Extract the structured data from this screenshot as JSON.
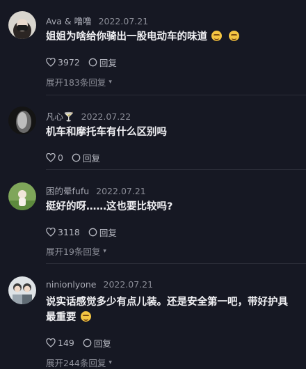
{
  "comments": [
    {
      "username": "Ava & 噜噜",
      "date": "2022.07.21",
      "text": "姐姐为啥给你骑出一股电动车的味道",
      "emoji": [
        "grin-emoji",
        "grin-emoji"
      ],
      "likes": "3972",
      "reply_label": "回复",
      "expand": "展开183条回复"
    },
    {
      "username": "凡心🍸",
      "date": "2022.07.22",
      "text": "机车和摩托车有什么区别吗",
      "likes": "0",
      "reply_label": "回复",
      "expand": ""
    },
    {
      "username": "困的晕fufu",
      "date": "2022.07.21",
      "text": "挺好的呀……这也要比较吗?",
      "likes": "3118",
      "reply_label": "回复",
      "expand": "展开19条回复"
    },
    {
      "username": "ninionlyone",
      "date": "2022.07.21",
      "text": "说实话感觉多少有点儿装。还是安全第一吧，带好护具最重要",
      "emoji": [
        "smile-emoji"
      ],
      "likes": "149",
      "reply_label": "回复",
      "expand": "展开244条回复"
    }
  ],
  "colors": {
    "background": "#161823",
    "text": "#f0f0f3",
    "muted": "#8b8d97"
  }
}
